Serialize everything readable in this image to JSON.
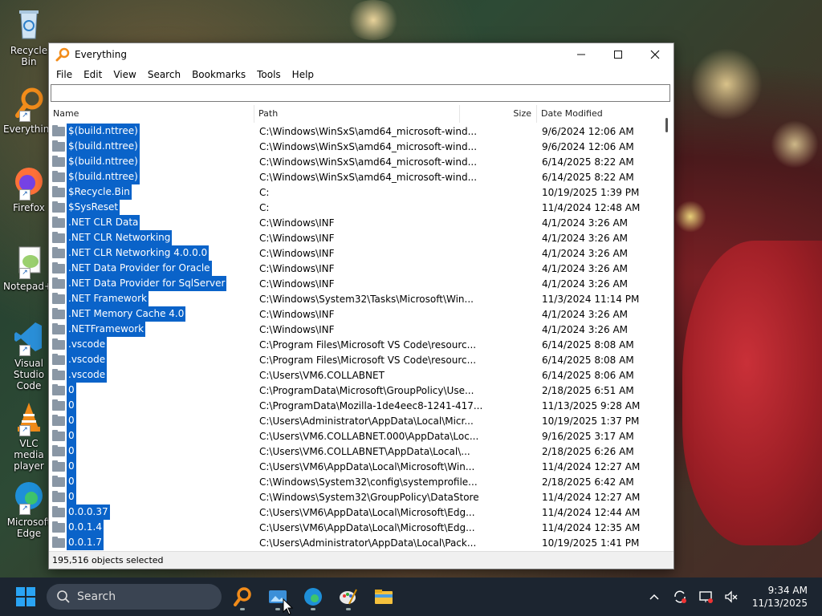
{
  "desktop": {
    "icons": [
      {
        "label": "Recycle Bin",
        "icon": "recycle-bin-icon"
      },
      {
        "label": "Everything",
        "icon": "everything-icon"
      },
      {
        "label": "Firefox",
        "icon": "firefox-icon"
      },
      {
        "label": "Notepad++",
        "icon": "notepad-plus-plus-icon"
      },
      {
        "label": "Visual Studio Code",
        "icon": "vscode-icon"
      },
      {
        "label": "VLC media player",
        "icon": "vlc-icon"
      },
      {
        "label": "Microsoft Edge",
        "icon": "edge-icon"
      }
    ]
  },
  "window": {
    "title": "Everything",
    "menu": [
      "File",
      "Edit",
      "View",
      "Search",
      "Bookmarks",
      "Tools",
      "Help"
    ],
    "search": {
      "value": "",
      "placeholder": ""
    },
    "columns": {
      "name": "Name",
      "path": "Path",
      "size": "Size",
      "date": "Date Modified"
    },
    "rows": [
      {
        "name": "$(build.nttree)",
        "path": "C:\\Windows\\WinSxS\\amd64_microsoft-wind...",
        "date": "9/6/2024 12:06 AM"
      },
      {
        "name": "$(build.nttree)",
        "path": "C:\\Windows\\WinSxS\\amd64_microsoft-wind...",
        "date": "9/6/2024 12:06 AM"
      },
      {
        "name": "$(build.nttree)",
        "path": "C:\\Windows\\WinSxS\\amd64_microsoft-wind...",
        "date": "6/14/2025 8:22 AM"
      },
      {
        "name": "$(build.nttree)",
        "path": "C:\\Windows\\WinSxS\\amd64_microsoft-wind...",
        "date": "6/14/2025 8:22 AM"
      },
      {
        "name": "$Recycle.Bin",
        "path": "C:",
        "date": "10/19/2025 1:39 PM"
      },
      {
        "name": "$SysReset",
        "path": "C:",
        "date": "11/4/2024 12:48 AM"
      },
      {
        "name": ".NET CLR Data",
        "path": "C:\\Windows\\INF",
        "date": "4/1/2024 3:26 AM"
      },
      {
        "name": ".NET CLR Networking",
        "path": "C:\\Windows\\INF",
        "date": "4/1/2024 3:26 AM"
      },
      {
        "name": ".NET CLR Networking 4.0.0.0",
        "path": "C:\\Windows\\INF",
        "date": "4/1/2024 3:26 AM"
      },
      {
        "name": ".NET Data Provider for Oracle",
        "path": "C:\\Windows\\INF",
        "date": "4/1/2024 3:26 AM"
      },
      {
        "name": ".NET Data Provider for SqlServer",
        "path": "C:\\Windows\\INF",
        "date": "4/1/2024 3:26 AM"
      },
      {
        "name": ".NET Framework",
        "path": "C:\\Windows\\System32\\Tasks\\Microsoft\\Win...",
        "date": "11/3/2024 11:14 PM"
      },
      {
        "name": ".NET Memory Cache 4.0",
        "path": "C:\\Windows\\INF",
        "date": "4/1/2024 3:26 AM"
      },
      {
        "name": ".NETFramework",
        "path": "C:\\Windows\\INF",
        "date": "4/1/2024 3:26 AM"
      },
      {
        "name": ".vscode",
        "path": "C:\\Program Files\\Microsoft VS Code\\resourc...",
        "date": "6/14/2025 8:08 AM"
      },
      {
        "name": ".vscode",
        "path": "C:\\Program Files\\Microsoft VS Code\\resourc...",
        "date": "6/14/2025 8:08 AM"
      },
      {
        "name": ".vscode",
        "path": "C:\\Users\\VM6.COLLABNET",
        "date": "6/14/2025 8:06 AM"
      },
      {
        "name": "0",
        "path": "C:\\ProgramData\\Microsoft\\GroupPolicy\\Use...",
        "date": "2/18/2025 6:51 AM"
      },
      {
        "name": "0",
        "path": "C:\\ProgramData\\Mozilla-1de4eec8-1241-417...",
        "date": "11/13/2025 9:28 AM"
      },
      {
        "name": "0",
        "path": "C:\\Users\\Administrator\\AppData\\Local\\Micr...",
        "date": "10/19/2025 1:37 PM"
      },
      {
        "name": "0",
        "path": "C:\\Users\\VM6.COLLABNET.000\\AppData\\Loc...",
        "date": "9/16/2025 3:17 AM"
      },
      {
        "name": "0",
        "path": "C:\\Users\\VM6.COLLABNET\\AppData\\Local\\...",
        "date": "2/18/2025 6:26 AM"
      },
      {
        "name": "0",
        "path": "C:\\Users\\VM6\\AppData\\Local\\Microsoft\\Win...",
        "date": "11/4/2024 12:27 AM"
      },
      {
        "name": "0",
        "path": "C:\\Windows\\System32\\config\\systemprofile...",
        "date": "2/18/2025 6:42 AM"
      },
      {
        "name": "0",
        "path": "C:\\Windows\\System32\\GroupPolicy\\DataStore",
        "date": "11/4/2024 12:27 AM"
      },
      {
        "name": "0.0.0.37",
        "path": "C:\\Users\\VM6\\AppData\\Local\\Microsoft\\Edg...",
        "date": "11/4/2024 12:44 AM"
      },
      {
        "name": "0.0.1.4",
        "path": "C:\\Users\\VM6\\AppData\\Local\\Microsoft\\Edg...",
        "date": "11/4/2024 12:35 AM"
      },
      {
        "name": "0.0.1.7",
        "path": "C:\\Users\\Administrator\\AppData\\Local\\Pack...",
        "date": "10/19/2025 1:41 PM"
      }
    ],
    "status": "195,516 objects selected"
  },
  "taskbar": {
    "search_label": "Search",
    "apps": [
      "everything-icon",
      "photos-icon",
      "edge-icon",
      "paint-icon",
      "file-explorer-icon"
    ],
    "time": "9:34 AM",
    "date": "11/13/2025"
  },
  "colors": {
    "selection": "#0a63c9",
    "taskbar": "#1c2530"
  }
}
